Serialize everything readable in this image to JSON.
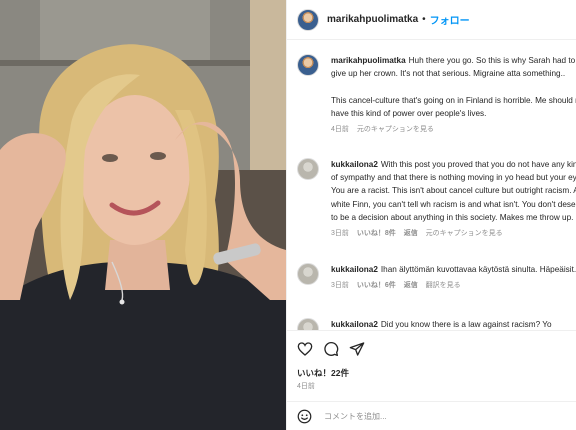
{
  "photo": {
    "alt_icon": "woman-photo"
  },
  "header": {
    "username": "marikahpuolimatka",
    "separator": "•",
    "follow_label": "フォロー"
  },
  "comments": [
    {
      "username": "marikahpuolimatka",
      "text": "Huh there you go. So this is why Sarah had to give up her crown. It's not that serious. Migraine atta something..\n\nThis cancel-culture that's going on in Finland is horrible. Me should not have this kind of power over people's lives.",
      "meta": {
        "time": "4日前",
        "caption_link": "元のキャプションを見る"
      }
    },
    {
      "username": "kukkailona2",
      "text": "With this post you proved that you do not have any kind of sympathy and that there is nothing moving in yo head but your eyes. You are a racist. This isn't about cancel culture but outright racism. As a white Finn, you can't tell wh racism is and what isn't. You don't deserve to be a decision about anything in this society. Makes me throw up.",
      "meta": {
        "time": "3日前",
        "likes": "いいね！8件",
        "reply": "返信",
        "caption_link": "元のキャプションを見る"
      }
    },
    {
      "username": "kukkailona2",
      "text": "Ihan älyttömän kuvottavaa käytöstä sinulta. Häpeäisit.",
      "meta": {
        "time": "3日前",
        "likes": "いいね！6件",
        "reply": "返信",
        "translate": "翻訳を見る"
      }
    },
    {
      "username": "kukkailona2",
      "text": "Did you know there is a law against racism? Yo",
      "meta": {}
    }
  ],
  "actions": {
    "icons": [
      "heart-icon",
      "comment-icon",
      "share-icon"
    ],
    "likes": "いいね！22件",
    "age": "4日前",
    "comment_placeholder": "コメントを追加..."
  }
}
